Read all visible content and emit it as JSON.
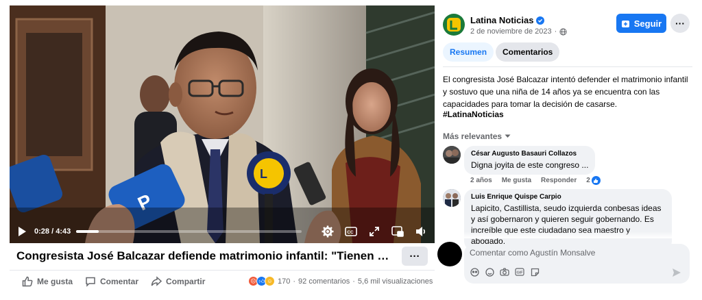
{
  "video": {
    "current_time": "0:28",
    "separator": "/",
    "duration": "4:43",
    "progress_fraction": 0.099,
    "mic_logo_text": "LATINA\nNOTICIAS"
  },
  "post": {
    "title": "Congresista José Balcazar defiende matrimonio infantil: \"Tienen madur...",
    "actions": {
      "like": "Me gusta",
      "comment": "Comentar",
      "share": "Compartir"
    },
    "reaction_count": "170",
    "comments_count": "92 comentarios",
    "views": "5,6 mil visualizaciones",
    "dot": "·"
  },
  "page": {
    "name": "Latina Noticias",
    "date": "2 de noviembre de 2023",
    "follow_label": "Seguir",
    "more_label": "···"
  },
  "tabs": {
    "summary": "Resumen",
    "comments": "Comentarios"
  },
  "description": "El congresista José Balcazar intentó defender el matrimonio infantil y sostuvo que una niña de 14 años ya se encuentra con las capacidades para tomar la decisión de casarse.",
  "hashtag": "#LatinaNoticias",
  "sort_label": "Más relevantes",
  "comments": [
    {
      "author": "César Augusto Basauri Collazos",
      "text": "Digna joyita de este congreso ...",
      "age": "2 años",
      "like_label": "Me gusta",
      "reply_label": "Responder",
      "likes": "2"
    },
    {
      "author": "Luis Enrique Quispe Carpio",
      "text": "Lapicito, Castillista, seudo izquierda conbesas ideas y así gobernaron y quieren seguir gobernando. Es increíble que este ciudadano sea maestro y abogado,"
    }
  ],
  "composer": {
    "placeholder": "Comentar como Agustín Monsalve"
  },
  "colors": {
    "brand_blue": "#1877f2",
    "latina_green": "#1b7a3a",
    "latina_yellow": "#f5c400"
  }
}
